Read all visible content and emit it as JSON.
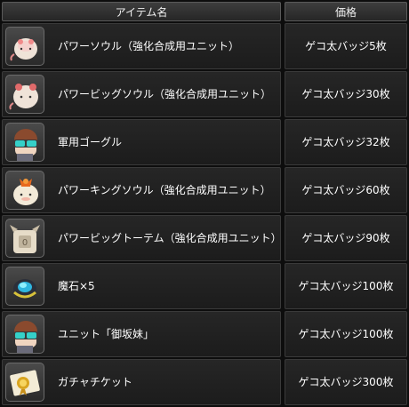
{
  "header": {
    "name_label": "アイテム名",
    "price_label": "価格"
  },
  "items": [
    {
      "name": "パワーソウル（強化合成用ユニット）",
      "price": "ゲコ太バッジ5枚",
      "icon": "power-soul-icon"
    },
    {
      "name": "パワービッグソウル（強化合成用ユニット）",
      "price": "ゲコ太バッジ30枚",
      "icon": "power-big-soul-icon"
    },
    {
      "name": "軍用ゴーグル",
      "price": "ゲコ太バッジ32枚",
      "icon": "military-goggles-icon"
    },
    {
      "name": "パワーキングソウル（強化合成用ユニット）",
      "price": "ゲコ太バッジ60枚",
      "icon": "power-king-soul-icon"
    },
    {
      "name": "パワービッグトーテム（強化合成用ユニット）",
      "price": "ゲコ太バッジ90枚",
      "icon": "power-big-totem-icon"
    },
    {
      "name": "魔石×5",
      "price": "ゲコ太バッジ100枚",
      "icon": "magic-stone-icon"
    },
    {
      "name": "ユニット「御坂妹」",
      "price": "ゲコ太バッジ100枚",
      "icon": "misaka-imouto-icon"
    },
    {
      "name": "ガチャチケット",
      "price": "ゲコ太バッジ300枚",
      "icon": "gacha-ticket-icon"
    }
  ]
}
